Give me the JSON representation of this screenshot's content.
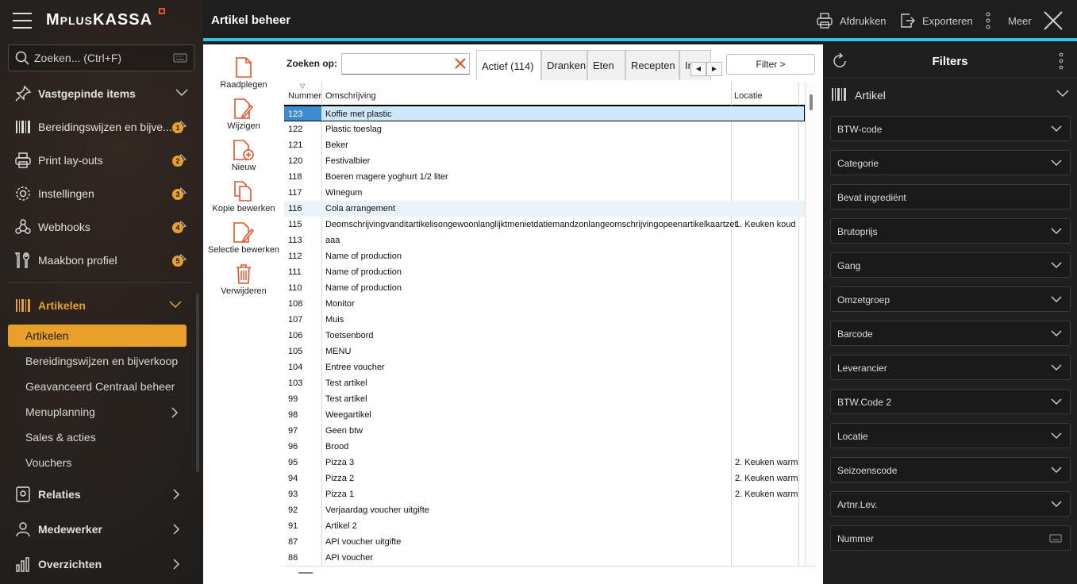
{
  "app": {
    "logo_text_m": "M",
    "logo_text_plus": "PLUS",
    "logo_text_kassa": "KASSA"
  },
  "search": {
    "placeholder": "Zoeken... (Ctrl+F)"
  },
  "sidebar": {
    "pinned_label": "Vastgepinde items",
    "pinned_items": [
      {
        "label": "Bereidingswijzen en bijve...",
        "badge": "1"
      },
      {
        "label": "Print lay-outs",
        "badge": "2"
      },
      {
        "label": "Instellingen",
        "badge": "3"
      },
      {
        "label": "Webhooks",
        "badge": "4"
      },
      {
        "label": "Maakbon profiel",
        "badge": "5"
      }
    ],
    "section_label": "Artikelen",
    "sub_items": [
      "Artikelen",
      "Bereidingswijzen en bijverkoop",
      "Geavanceerd Centraal beheer",
      "Menuplanning",
      "Sales & acties",
      "Vouchers"
    ],
    "bottom_items": [
      "Relaties",
      "Medewerker",
      "Overzichten"
    ]
  },
  "topbar": {
    "title": "Artikel beheer",
    "print": "Afdrukken",
    "export": "Exporteren",
    "more": "Meer"
  },
  "actions": [
    "Raadplegen",
    "Wijzigen",
    "Nieuw",
    "Kopie bewerken",
    "Selectie bewerken",
    "Verwijderen"
  ],
  "zoek": {
    "label": "Zoeken op:",
    "value": ""
  },
  "tabs": [
    "Actief (114)",
    "Dranken",
    "Eten",
    "Recepten",
    "In"
  ],
  "filter_button": "Filter >",
  "table": {
    "headers": [
      "Nummer",
      "Omschrijving",
      "Locatie"
    ],
    "rows": [
      [
        "123",
        "Koffie met plastic",
        ""
      ],
      [
        "122",
        "Plastic toeslag",
        ""
      ],
      [
        "121",
        "Beker",
        ""
      ],
      [
        "120",
        "Festivalbier",
        ""
      ],
      [
        "118",
        "Boeren magere yoghurt 1/2 liter",
        ""
      ],
      [
        "117",
        "Winegum",
        ""
      ],
      [
        "116",
        "Cola arrangement",
        ""
      ],
      [
        "115",
        "Deomschrijvingvanditartikelisongewoonlanglijktmenietdatiemandzonlangeomschrijvingopeenartikelkaartzet",
        "1. Keuken koud"
      ],
      [
        "113",
        "aaa",
        ""
      ],
      [
        "112",
        "Name of production",
        ""
      ],
      [
        "111",
        "Name of production",
        ""
      ],
      [
        "110",
        "Name of production",
        ""
      ],
      [
        "108",
        "Monitor",
        ""
      ],
      [
        "107",
        "Muis",
        ""
      ],
      [
        "106",
        "Toetsenbord",
        ""
      ],
      [
        "105",
        "MENU",
        ""
      ],
      [
        "104",
        "Entree voucher",
        ""
      ],
      [
        "103",
        "Test artikel",
        ""
      ],
      [
        "99",
        "Test artikel",
        ""
      ],
      [
        "98",
        "Weegartikel",
        ""
      ],
      [
        "97",
        "Geen btw",
        ""
      ],
      [
        "96",
        "Brood",
        ""
      ],
      [
        "95",
        "Pizza 3",
        "2. Keuken warm"
      ],
      [
        "94",
        "Pizza 2",
        "2. Keuken warm"
      ],
      [
        "93",
        "Pizza 1",
        "2. Keuken warm"
      ],
      [
        "92",
        "Verjaardag voucher uitgifte",
        ""
      ],
      [
        "91",
        "Artikel 2",
        ""
      ],
      [
        "87",
        "API voucher uitgifte",
        ""
      ],
      [
        "86",
        "API voucher",
        ""
      ]
    ]
  },
  "filters": {
    "title": "Filters",
    "group": "Artikel",
    "fields": [
      "BTW-code",
      "Categorie",
      "Bevat ingrediënt",
      "Brutoprijs",
      "Gang",
      "Omzetgroep",
      "Barcode",
      "Leverancier",
      "BTW.Code 2",
      "Locatie",
      "Seizoenscode",
      "Artnr.Lev.",
      "Nummer"
    ]
  },
  "colors": {
    "accent": "#e9a02a",
    "topbar_line": "#2cc4dc",
    "icon_orange": "#e6532b",
    "selection": "#cde8f8"
  }
}
